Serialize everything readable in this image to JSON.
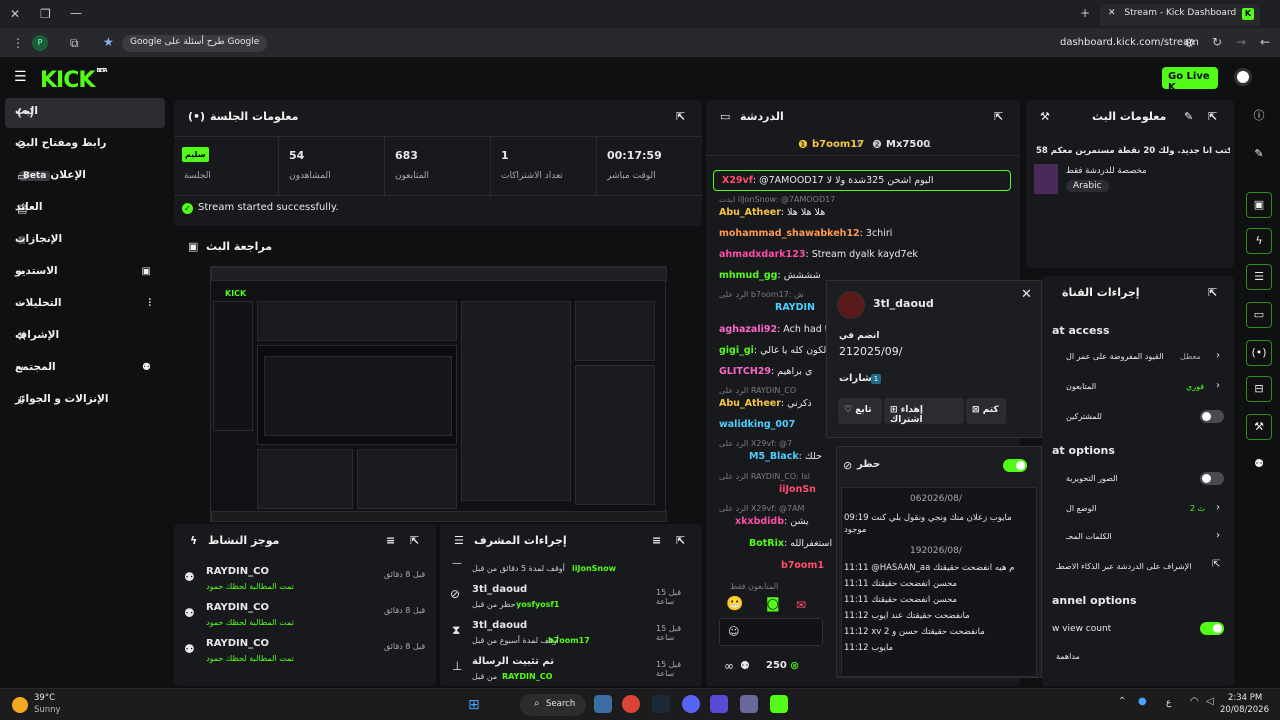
{
  "browser": {
    "tab_title": "Stream - Kick Dashboard",
    "url": "dashboard.kick.com/stream",
    "google_pill": "طرح أسئلة على Google",
    "profile_initial": "P"
  },
  "header": {
    "logo": "KICK",
    "logo_badge": "BETA",
    "go_live": "Go Live"
  },
  "sidebar": {
    "items": [
      {
        "label": "البث"
      },
      {
        "label": "رابط ومفتاح البث"
      },
      {
        "label": "الإعلان",
        "badge": "Beta"
      },
      {
        "label": "العائد"
      },
      {
        "label": "الإنجازات"
      },
      {
        "label": "الاستديو"
      },
      {
        "label": "التحليلات"
      },
      {
        "label": "الإشراف"
      },
      {
        "label": "المجتمع"
      },
      {
        "label": "الإنزالات و الجوائز"
      }
    ]
  },
  "session": {
    "title": "معلومات الجلسة",
    "stats": [
      {
        "value": "سليم",
        "label": "الجلسة"
      },
      {
        "value": "54",
        "label": "المشاهدون"
      },
      {
        "value": "683",
        "label": "المتابعون"
      },
      {
        "value": "1",
        "label": "تعداد الاشتراكات"
      },
      {
        "value": "00:17:59",
        "label": "الوقت مباشر"
      }
    ],
    "status": "Stream started successfully."
  },
  "preview": {
    "title": "مراجعة البث"
  },
  "activity": {
    "title": "موجز النشاط",
    "rows": [
      {
        "user": "RAYDIN_CO",
        "text": "تمت المطالبة لحظك حمود",
        "time": "قبل 8 دقائق"
      },
      {
        "user": "RAYDIN_CO",
        "text": "تمت المطالبة لحظك حمود",
        "time": "قبل 8 دقائق"
      },
      {
        "user": "RAYDIN_CO",
        "text": "تمت المطالبة لحظك حمود",
        "time": "قبل 8 دقائق"
      }
    ]
  },
  "mod_actions": {
    "title": "إجراءات المشرف",
    "rows": [
      {
        "user": "",
        "text": "أوقف لمدة 5 دقائق من قبل",
        "by": "iiJonSnow",
        "time": ""
      },
      {
        "user": "3tl_daoud",
        "text": "حظر من قبل",
        "by": "yosfyosf1",
        "time": "قبل 15 ساعة"
      },
      {
        "user": "3tl_daoud",
        "text": "أوقف لمدة أسبوع من قبل",
        "by": "b7oom17",
        "time": "قبل 15 ساعة"
      },
      {
        "user": "تم تثبيت الرسالة",
        "text": "من قبل",
        "by": "RAYDIN_CO",
        "time": "قبل 15 ساعة"
      }
    ]
  },
  "chat": {
    "title": "الدردشة",
    "leaders": [
      {
        "name": "b7oom17",
        "count": "1"
      },
      {
        "name": "Mx7500",
        "count": "1"
      }
    ],
    "lines": [
      {
        "user": "X29vf",
        "color": "#ff4d6d",
        "text": "@7AMOOD17 اليوم اشحن 325شدة ولا لا",
        "highlight": true
      },
      {
        "meta": "ايدت iiJonSnow: @7AMOOD17"
      },
      {
        "user": "Abu_Atheer",
        "color": "#f5c542",
        "text": "هلا هلا هلا"
      },
      {
        "user": "mohammad_shawabkeh12",
        "color": "#ff9a4d",
        "text": "3chiri"
      },
      {
        "user": "ahmadxdark123",
        "color": "#ff4da6",
        "text": "Stream dyalk kayd7ek"
      },
      {
        "user": "mhmud_gg",
        "color": "#53fc18",
        "text": "شششش"
      },
      {
        "meta": "الرد على b7oom17: ش"
      },
      {
        "user": "RAYDIN",
        "color": "#4dd0ff",
        "text": ""
      },
      {
        "user": "aghazali92",
        "color": "#ff66cc",
        "text": "Ach had t"
      },
      {
        "user": "gigi_gi",
        "color": "#53fc18",
        "text": "الكون كله يا غالي"
      },
      {
        "user": "GLITCH29",
        "color": "#ff66cc",
        "text": "ي براهيم"
      },
      {
        "meta": "الرد على RAYDIN_CO"
      },
      {
        "user": "Abu_Atheer",
        "color": "#f5c542",
        "text": "ذكرني"
      },
      {
        "user": "walidking_007",
        "color": "#4dd0ff",
        "text": ""
      },
      {
        "meta": "الرد على X29vf: @7"
      },
      {
        "user": "M5_Black",
        "color": "#4dd0ff",
        "text": "حلك"
      },
      {
        "meta": "الرد على RAYDIN_CO: Isl"
      },
      {
        "user": "iiJonSn",
        "color": "#ff4d6d",
        "text": ""
      },
      {
        "meta": "الرد على X29vf: @7AM"
      },
      {
        "user": "xkxbdidb",
        "color": "#ff4da6",
        "text": "يشن"
      },
      {
        "user": "BotRix",
        "color": "#53fc18",
        "text": "استغفرالله"
      },
      {
        "user": "b7oom1",
        "color": "#ff4d6d",
        "text": ""
      }
    ],
    "followers_only": "المتابعون فقط",
    "viewer_count": "250"
  },
  "user_card": {
    "username": "3tl_daoud",
    "joined_label": "انضم في",
    "joined_date": "212025/09/",
    "badges_label": "شارات",
    "badges_count": "1",
    "buttons": [
      "كتم",
      "إهداء اشتراك",
      "تابع"
    ]
  },
  "ban_card": {
    "label": "حظر",
    "dates": [
      "062026/08/",
      "192026/08/"
    ],
    "messages": [
      {
        "time": "09:19",
        "text": "مايوب زعلان منك ونجي ونقول بلي كنت موجود"
      },
      {
        "time": "11:11",
        "text": "@HASAAN_aa م هيه انفضحت حقيقتك"
      },
      {
        "time": "11:11",
        "text": "محسن انفضحت حقيقتك"
      },
      {
        "time": "11:11",
        "text": "محسن انفضحت حقيقتك"
      },
      {
        "time": "11:12",
        "text": "مانفضحت حقيقتك عند ايوب"
      },
      {
        "time": "11:12",
        "text": "xv مانفضحت حقيقتك حسن و 2"
      },
      {
        "time": "11:12",
        "text": "مايوب"
      }
    ]
  },
  "stream_info": {
    "title": "معلومات البث",
    "description": "اكتب انا جديد. ولك 20 نقطة مستمرين معكم 58#",
    "category": "مخصصة للدردشة فقط",
    "language": "Arabic"
  },
  "channel_actions": {
    "title": "إجراءات القناة",
    "section1": "at access",
    "rows1": [
      {
        "label": "القيود المفروضة على عمر ال",
        "value": "معطل"
      },
      {
        "label": "المتابعون",
        "value": "فوري"
      },
      {
        "label": "للمشتركين",
        "value": ""
      }
    ],
    "section2": "at options",
    "rows2": [
      {
        "label": "الصور التحويرية",
        "value": ""
      },
      {
        "label": "الوضع ال",
        "value": "2 ث"
      },
      {
        "label": "الكلمات المحـ",
        "value": ""
      },
      {
        "label": "الإشراف على الدردشة عبر الذكاء الاصطـ",
        "value": ""
      }
    ],
    "section3": "annel options",
    "rows3": [
      {
        "label": "w view count",
        "value": ""
      },
      {
        "label": "مداهمة",
        "value": ""
      }
    ]
  },
  "taskbar": {
    "weather_temp": "39°C",
    "weather_text": "Sunny",
    "search": "Search",
    "time": "2:34 PM",
    "date": "20/08/2026",
    "lang": "ع"
  }
}
